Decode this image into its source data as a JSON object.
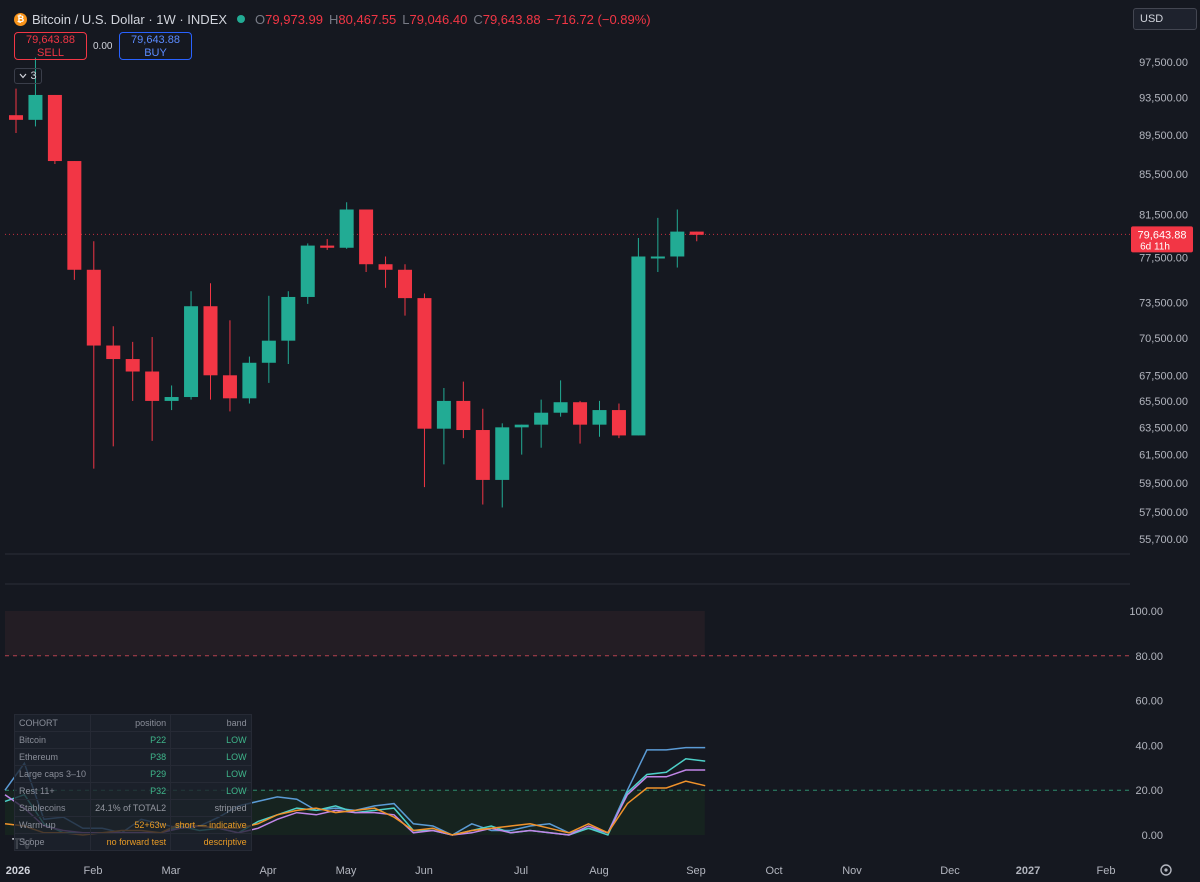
{
  "header": {
    "coin_glyph": "₿",
    "symbol": "Bitcoin / U.S. Dollar · 1W · INDEX",
    "open_key": "O",
    "open": "79,973.99",
    "high_key": "H",
    "high": "80,467.55",
    "low_key": "L",
    "low": "79,046.40",
    "close_key": "C",
    "close": "79,643.88",
    "change": "−716.72 (−0.89%)"
  },
  "trade": {
    "sell_price": "79,643.88",
    "sell_label": "SELL",
    "spread": "0.00",
    "buy_price": "79,643.88",
    "buy_label": "BUY"
  },
  "collapse_count": "3",
  "currency": "USD",
  "price_label": {
    "value": "79,643.88",
    "countdown": "6d 11h"
  },
  "colors": {
    "up": "#22ab94",
    "down": "#f23645",
    "background": "#151820",
    "bitcoin": "#5b9bd5",
    "ethereum": "#4dd0c8",
    "large_caps": "#c186e8",
    "rest": "#f0922b",
    "stablecoins": "#7a8190"
  },
  "chart_data": [
    {
      "type": "candlestick",
      "title": "Bitcoin / U.S. Dollar · 1W · INDEX",
      "y_scale": "log",
      "ylim": [
        55000,
        99500
      ],
      "y_ticks": [
        "97,500.00",
        "93,500.00",
        "89,500.00",
        "85,500.00",
        "81,500.00",
        "77,500.00",
        "73,500.00",
        "70,500.00",
        "67,500.00",
        "65,500.00",
        "63,500.00",
        "61,500.00",
        "59,500.00",
        "57,500.00",
        "55,700.00"
      ],
      "current_price": 79643.88,
      "candles": [
        {
          "o": 91600,
          "h": 94500,
          "l": 89700,
          "c": 91100
        },
        {
          "o": 91100,
          "h": 98000,
          "l": 90400,
          "c": 93800
        },
        {
          "o": 93800,
          "h": 93800,
          "l": 86500,
          "c": 86800
        },
        {
          "o": 86800,
          "h": 86800,
          "l": 75500,
          "c": 76400
        },
        {
          "o": 76400,
          "h": 79000,
          "l": 60500,
          "c": 69900
        },
        {
          "o": 69900,
          "h": 71500,
          "l": 62100,
          "c": 68800
        },
        {
          "o": 68800,
          "h": 70200,
          "l": 65500,
          "c": 67800
        },
        {
          "o": 67800,
          "h": 70600,
          "l": 62500,
          "c": 65500
        },
        {
          "o": 65500,
          "h": 66700,
          "l": 64800,
          "c": 65800
        },
        {
          "o": 65800,
          "h": 74500,
          "l": 65600,
          "c": 73200
        },
        {
          "o": 73200,
          "h": 75200,
          "l": 65600,
          "c": 67500
        },
        {
          "o": 67500,
          "h": 72000,
          "l": 64700,
          "c": 65700
        },
        {
          "o": 65700,
          "h": 69000,
          "l": 65300,
          "c": 68500
        },
        {
          "o": 68500,
          "h": 74100,
          "l": 66900,
          "c": 70300
        },
        {
          "o": 70300,
          "h": 74500,
          "l": 68400,
          "c": 74000
        },
        {
          "o": 74000,
          "h": 78800,
          "l": 73400,
          "c": 78600
        },
        {
          "o": 78600,
          "h": 79200,
          "l": 78200,
          "c": 78400
        },
        {
          "o": 78400,
          "h": 82700,
          "l": 78300,
          "c": 82000
        },
        {
          "o": 82000,
          "h": 82000,
          "l": 76200,
          "c": 76900
        },
        {
          "o": 76900,
          "h": 77600,
          "l": 74800,
          "c": 76400
        },
        {
          "o": 76400,
          "h": 76900,
          "l": 72400,
          "c": 73900
        },
        {
          "o": 73900,
          "h": 74300,
          "l": 59200,
          "c": 63400
        },
        {
          "o": 63400,
          "h": 66500,
          "l": 60800,
          "c": 65500
        },
        {
          "o": 65500,
          "h": 67000,
          "l": 62700,
          "c": 63300
        },
        {
          "o": 63300,
          "h": 64900,
          "l": 58000,
          "c": 59700
        },
        {
          "o": 59700,
          "h": 63800,
          "l": 57800,
          "c": 63500
        },
        {
          "o": 63500,
          "h": 63700,
          "l": 61500,
          "c": 63700
        },
        {
          "o": 63700,
          "h": 65600,
          "l": 62000,
          "c": 64600
        },
        {
          "o": 64600,
          "h": 67100,
          "l": 64300,
          "c": 65400
        },
        {
          "o": 65400,
          "h": 65500,
          "l": 62300,
          "c": 63700
        },
        {
          "o": 63700,
          "h": 65500,
          "l": 62800,
          "c": 64800
        },
        {
          "o": 64800,
          "h": 65300,
          "l": 62700,
          "c": 62900
        },
        {
          "o": 62900,
          "h": 79300,
          "l": 62900,
          "c": 77600
        },
        {
          "o": 77600,
          "h": 81200,
          "l": 76200,
          "c": 77600
        },
        {
          "o": 77600,
          "h": 82000,
          "l": 76600,
          "c": 79900
        },
        {
          "o": 79900,
          "h": 79900,
          "l": 79000,
          "c": 79600
        }
      ]
    },
    {
      "type": "line",
      "ylim": [
        0,
        100
      ],
      "y_ticks": [
        "100.00",
        "80.00",
        "60.00",
        "40.00",
        "20.00",
        "0.00"
      ],
      "reference_lines": [
        80,
        20
      ],
      "series": [
        {
          "name": "Bitcoin",
          "values": [
            20,
            32,
            7,
            8,
            3,
            3,
            1,
            7,
            5,
            3,
            4,
            8,
            13,
            15,
            17,
            16,
            11,
            12,
            11,
            13,
            14,
            5,
            4,
            0,
            5,
            2,
            2,
            4,
            5,
            1,
            3,
            1,
            20,
            38,
            38,
            39,
            39
          ]
        },
        {
          "name": "Ethereum",
          "values": [
            15,
            18,
            5,
            1,
            1,
            1,
            1,
            1,
            1,
            4,
            2,
            3,
            1,
            6,
            9,
            12,
            11,
            13,
            10,
            11,
            12,
            2,
            2,
            0,
            2,
            4,
            1,
            2,
            1,
            0,
            3,
            0,
            19,
            27,
            28,
            34,
            33
          ]
        },
        {
          "name": "Large caps 3–10",
          "values": [
            18,
            12,
            4,
            2,
            1,
            1,
            1,
            1,
            1,
            3,
            4,
            3,
            1,
            3,
            7,
            10,
            9,
            11,
            10,
            10,
            9,
            1,
            2,
            0,
            1,
            3,
            1,
            2,
            1,
            0,
            4,
            1,
            18,
            26,
            26,
            29,
            29
          ]
        },
        {
          "name": "Rest 11+",
          "values": [
            5,
            4,
            1,
            1,
            0,
            1,
            2,
            2,
            1,
            5,
            4,
            3,
            3,
            5,
            9,
            11,
            12,
            10,
            11,
            12,
            8,
            2,
            3,
            0,
            2,
            3,
            4,
            5,
            3,
            1,
            5,
            1,
            14,
            21,
            21,
            24,
            22
          ]
        }
      ]
    }
  ],
  "x_axis": [
    "2026",
    "Feb",
    "Mar",
    "Apr",
    "May",
    "Jun",
    "Jul",
    "Aug",
    "Sep",
    "Oct",
    "Nov",
    "Dec",
    "2027",
    "Feb"
  ],
  "cohort_table": {
    "header": [
      "COHORT",
      "position",
      "band"
    ],
    "rows": [
      [
        "Bitcoin",
        "P22",
        "LOW"
      ],
      [
        "Ethereum",
        "P38",
        "LOW"
      ],
      [
        "Large caps 3–10",
        "P29",
        "LOW"
      ],
      [
        "Rest 11+",
        "P32",
        "LOW"
      ],
      [
        "Stablecoins",
        "24.1% of TOTAL2",
        "stripped"
      ],
      [
        "Warm-up",
        "52+63w",
        "short — indicative"
      ],
      [
        "Scope",
        "no forward test",
        "descriptive"
      ]
    ]
  },
  "watermark": "TV"
}
